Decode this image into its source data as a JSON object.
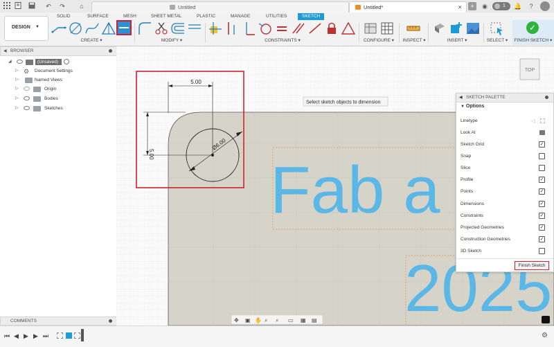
{
  "titlebar": {
    "tabs": [
      {
        "label": "Untitled",
        "active": false
      },
      {
        "label": "Untitled*",
        "active": true
      }
    ],
    "notification_count": "1"
  },
  "toolbar": {
    "workspace_label": "DESIGN",
    "tabs": [
      "SOLID",
      "SURFACE",
      "MESH",
      "SHEET METAL",
      "PLASTIC",
      "MANAGE",
      "UTILITIES",
      "SKETCH"
    ],
    "active_tab": "SKETCH",
    "groups": [
      "CREATE",
      "MODIFY",
      "CONSTRAINTS",
      "CONFIGURE",
      "INSPECT",
      "INSERT",
      "SELECT",
      "FINISH SKETCH"
    ]
  },
  "browser": {
    "title": "BROWSER",
    "root": "(Unsaved)",
    "items": [
      "Document Settings",
      "Named Views",
      "Origin",
      "Bodies",
      "Sketches"
    ]
  },
  "comments_label": "COMMENTS",
  "canvas": {
    "tooltip": "Select sketch objects to dimension",
    "view_cube_label": "TOP",
    "dim_horizontal": "5.00",
    "dim_vertical": "5.00",
    "dim_diameter": "Ø6.00",
    "text_line1": "Fab a",
    "text_line2": "2025"
  },
  "palette": {
    "title": "SKETCH PALETTE",
    "section": "Options",
    "rows": [
      {
        "label": "Linetype",
        "type": "icons"
      },
      {
        "label": "Look At",
        "type": "icon"
      },
      {
        "label": "Sketch Grid",
        "type": "check",
        "checked": true
      },
      {
        "label": "Snap",
        "type": "check",
        "checked": false
      },
      {
        "label": "Slice",
        "type": "check",
        "checked": false
      },
      {
        "label": "Profile",
        "type": "check",
        "checked": true
      },
      {
        "label": "Points",
        "type": "check",
        "checked": true
      },
      {
        "label": "Dimensions",
        "type": "check",
        "checked": true
      },
      {
        "label": "Constraints",
        "type": "check",
        "checked": true
      },
      {
        "label": "Projected Geometries",
        "type": "check",
        "checked": true
      },
      {
        "label": "Construction Geometries",
        "type": "check",
        "checked": true
      },
      {
        "label": "3D Sketch",
        "type": "check",
        "checked": false
      }
    ],
    "finish_label": "Finish Sketch"
  },
  "colors": {
    "accent": "#1d9bd7",
    "highlight_red": "#d0202a",
    "finish_green": "#2eb33c",
    "sketch_surface": "#d6d4c8",
    "text_blue": "#5bb8e6"
  }
}
